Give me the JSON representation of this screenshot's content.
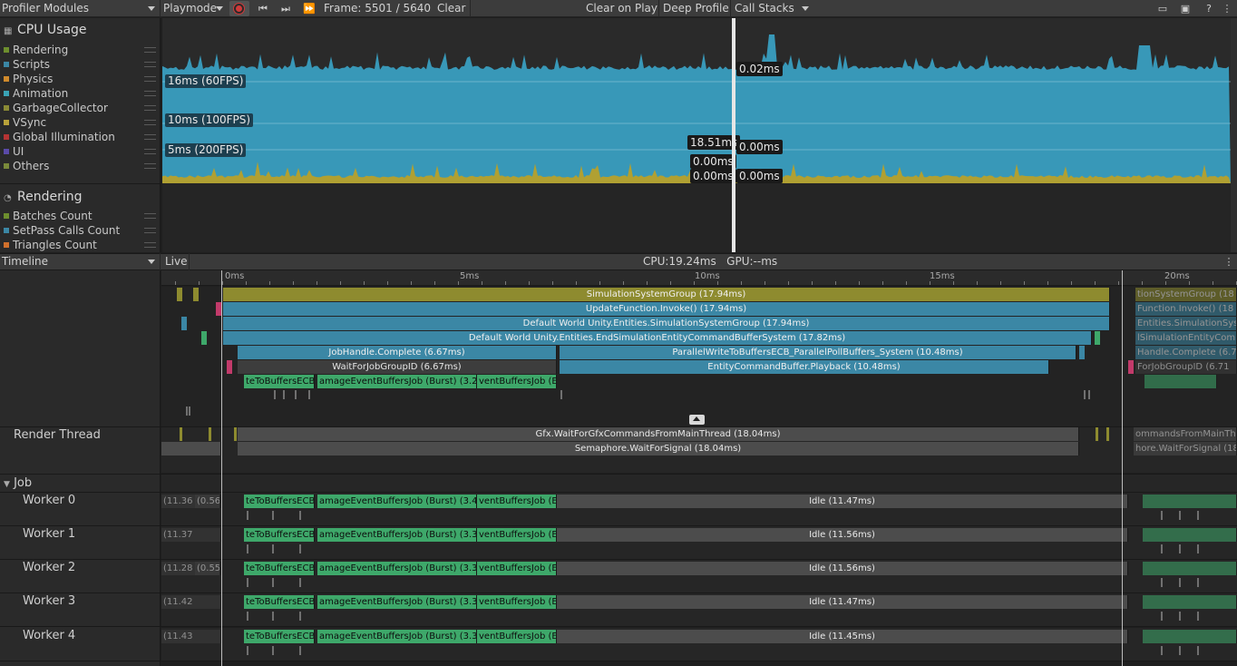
{
  "toolbar": {
    "modules_label": "Profiler Modules",
    "target_label": "Playmode",
    "frame_label": "Frame: 5501 / 5640",
    "clear_label": "Clear",
    "clear_on_play_label": "Clear on Play",
    "deep_profile_label": "Deep Profile",
    "call_stacks_label": "Call Stacks"
  },
  "cpu_module": {
    "title": "CPU Usage",
    "legend": [
      {
        "label": "Rendering",
        "color": "#6d8e2e"
      },
      {
        "label": "Scripts",
        "color": "#3b87a5"
      },
      {
        "label": "Physics",
        "color": "#d08a2c"
      },
      {
        "label": "Animation",
        "color": "#3aa3b5"
      },
      {
        "label": "GarbageCollector",
        "color": "#8a8a35"
      },
      {
        "label": "VSync",
        "color": "#b8a23a"
      },
      {
        "label": "Global Illumination",
        "color": "#b53333"
      },
      {
        "label": "UI",
        "color": "#5a4aa8"
      },
      {
        "label": "Others",
        "color": "#7a8a3a"
      }
    ],
    "fps_lines": [
      "16ms (60FPS)",
      "10ms (100FPS)",
      "5ms (200FPS)"
    ],
    "tooltips": [
      "0.02ms",
      "18.51ms",
      "0.00ms",
      "0.00ms",
      "0.00ms",
      "0.00ms"
    ]
  },
  "rendering_module": {
    "title": "Rendering",
    "legend": [
      {
        "label": "Batches Count",
        "color": "#6d8e2e"
      },
      {
        "label": "SetPass Calls Count",
        "color": "#3b87a5"
      },
      {
        "label": "Triangles Count",
        "color": "#d0702c"
      }
    ]
  },
  "timeline": {
    "view_label": "Timeline",
    "live_label": "Live",
    "cpu_gpu_label": "CPU:19.24ms   GPU:--ms",
    "ticks": [
      "0ms",
      "5ms",
      "10ms",
      "15ms",
      "20ms"
    ],
    "main_thread": {
      "bars": [
        "SimulationSystemGroup (17.94ms)",
        "UpdateFunction.Invoke() (17.94ms)",
        "Default World Unity.Entities.SimulationSystemGroup (17.94ms)",
        "Default World Unity.Entities.EndSimulationEntityCommandBufferSystem (17.82ms)",
        "JobHandle.Complete (6.67ms)",
        "ParallelWriteToBuffersECB_ParallelPollBuffers_System (10.48ms)",
        "WaitForJobGroupID (6.67ms)",
        "EntityCommandBuffer.Playback (10.48ms)",
        "teToBuffersECB",
        "amageEventBuffersJob (Burst) (3.2",
        "ventBuffersJob (E"
      ],
      "next_frame": [
        "tionSystemGroup (18",
        "Function.Invoke() (18",
        "Entities.SimulationSyst",
        "lSimulationEntityCom",
        "Handle.Complete (6.7",
        "ForJobGroupID (6.71"
      ]
    },
    "render_thread": {
      "label": "Render Thread",
      "bars": [
        "Gfx.WaitForGfxCommandsFromMainThread (18.04ms)",
        "Semaphore.WaitForSignal (18.04ms)"
      ],
      "next_frame": [
        "ommandsFromMainTh",
        "hore.WaitForSignal (18"
      ]
    },
    "job_group_label": "Job",
    "workers": [
      {
        "name": "Worker 0",
        "pre": [
          "(11.36",
          "(0.56"
        ],
        "j1": "teToBuffersECB",
        "j2": "amageEventBuffersJob (Burst) (3.4",
        "j3": "ventBuffersJob (E",
        "idle": "Idle (11.47ms)"
      },
      {
        "name": "Worker 1",
        "pre": [
          "(11.37"
        ],
        "j1": "teToBuffersECB",
        "j2": "amageEventBuffersJob (Burst) (3.3",
        "j3": "ventBuffersJob (E",
        "idle": "Idle (11.56ms)"
      },
      {
        "name": "Worker 2",
        "pre": [
          "(11.28",
          "(0.55"
        ],
        "j1": "teToBuffersECB",
        "j2": "amageEventBuffersJob (Burst) (3.3",
        "j3": "ventBuffersJob (E",
        "idle": "Idle (11.56ms)"
      },
      {
        "name": "Worker 3",
        "pre": [
          "(11.42"
        ],
        "j1": "teToBuffersECB",
        "j2": "amageEventBuffersJob (Burst) (3.3",
        "j3": "ventBuffersJob (E",
        "idle": "Idle (11.47ms)"
      },
      {
        "name": "Worker 4",
        "pre": [
          "(11.43"
        ],
        "j1": "teToBuffersECB",
        "j2": "amageEventBuffersJob (Burst) (3.3",
        "j3": "ventBuffersJob (E",
        "idle": "Idle (11.45ms)"
      }
    ]
  }
}
